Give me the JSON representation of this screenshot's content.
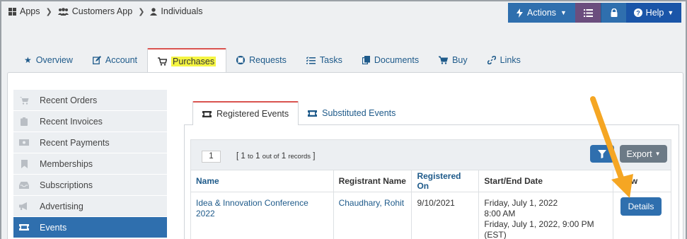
{
  "breadcrumb": {
    "items": [
      {
        "label": "Apps",
        "icon": "apps-grid-icon"
      },
      {
        "label": "Customers App",
        "icon": "users-icon"
      },
      {
        "label": "Individuals",
        "icon": "user-icon"
      }
    ]
  },
  "toolbar": {
    "actions_label": "Actions",
    "help_label": "Help"
  },
  "main_tabs": [
    {
      "label": "Overview",
      "icon": "star-icon"
    },
    {
      "label": "Account",
      "icon": "edit-icon"
    },
    {
      "label": "Purchases",
      "icon": "cart-icon",
      "active": true
    },
    {
      "label": "Requests",
      "icon": "lifebuoy-icon"
    },
    {
      "label": "Tasks",
      "icon": "tasks-icon"
    },
    {
      "label": "Documents",
      "icon": "documents-icon"
    },
    {
      "label": "Buy",
      "icon": "cart-icon"
    },
    {
      "label": "Links",
      "icon": "link-icon"
    }
  ],
  "sidebar": {
    "items": [
      {
        "label": "Recent Orders",
        "icon": "cart-icon"
      },
      {
        "label": "Recent Invoices",
        "icon": "clipboard-icon"
      },
      {
        "label": "Recent Payments",
        "icon": "money-icon"
      },
      {
        "label": "Memberships",
        "icon": "bookmark-icon"
      },
      {
        "label": "Subscriptions",
        "icon": "inbox-icon"
      },
      {
        "label": "Advertising",
        "icon": "megaphone-icon"
      },
      {
        "label": "Events",
        "icon": "ticket-icon",
        "active": true
      }
    ]
  },
  "sub_tabs": [
    {
      "label": "Registered Events",
      "icon": "ticket-icon",
      "active": true
    },
    {
      "label": "Substituted Events",
      "icon": "ticket-icon"
    }
  ],
  "pager": {
    "page": "1",
    "from": "1",
    "to_word": "to",
    "to": "1",
    "out_of_word": "out of",
    "total": "1",
    "records_word": "records"
  },
  "export_label": "Export",
  "table": {
    "columns": [
      "Name",
      "Registrant Name",
      "Registered On",
      "Start/End Date",
      "View"
    ],
    "rows": [
      {
        "name": "Idea & Innovation Conference 2022",
        "registrant": "Chaudhary, Rohit",
        "registered_on": "9/10/2021",
        "start_line1": "Friday, July 1, 2022",
        "start_line2": "8:00 AM",
        "end_line": "Friday, July 1, 2022, 9:00 PM (EST)",
        "action_label": "Details"
      }
    ]
  },
  "colors": {
    "primary": "#2f6fae",
    "help": "#1a55a8",
    "list": "#6b4e7e",
    "active_tab_border": "#d9534f",
    "highlight": "#f5f542",
    "annotation_arrow": "#f5a623"
  }
}
